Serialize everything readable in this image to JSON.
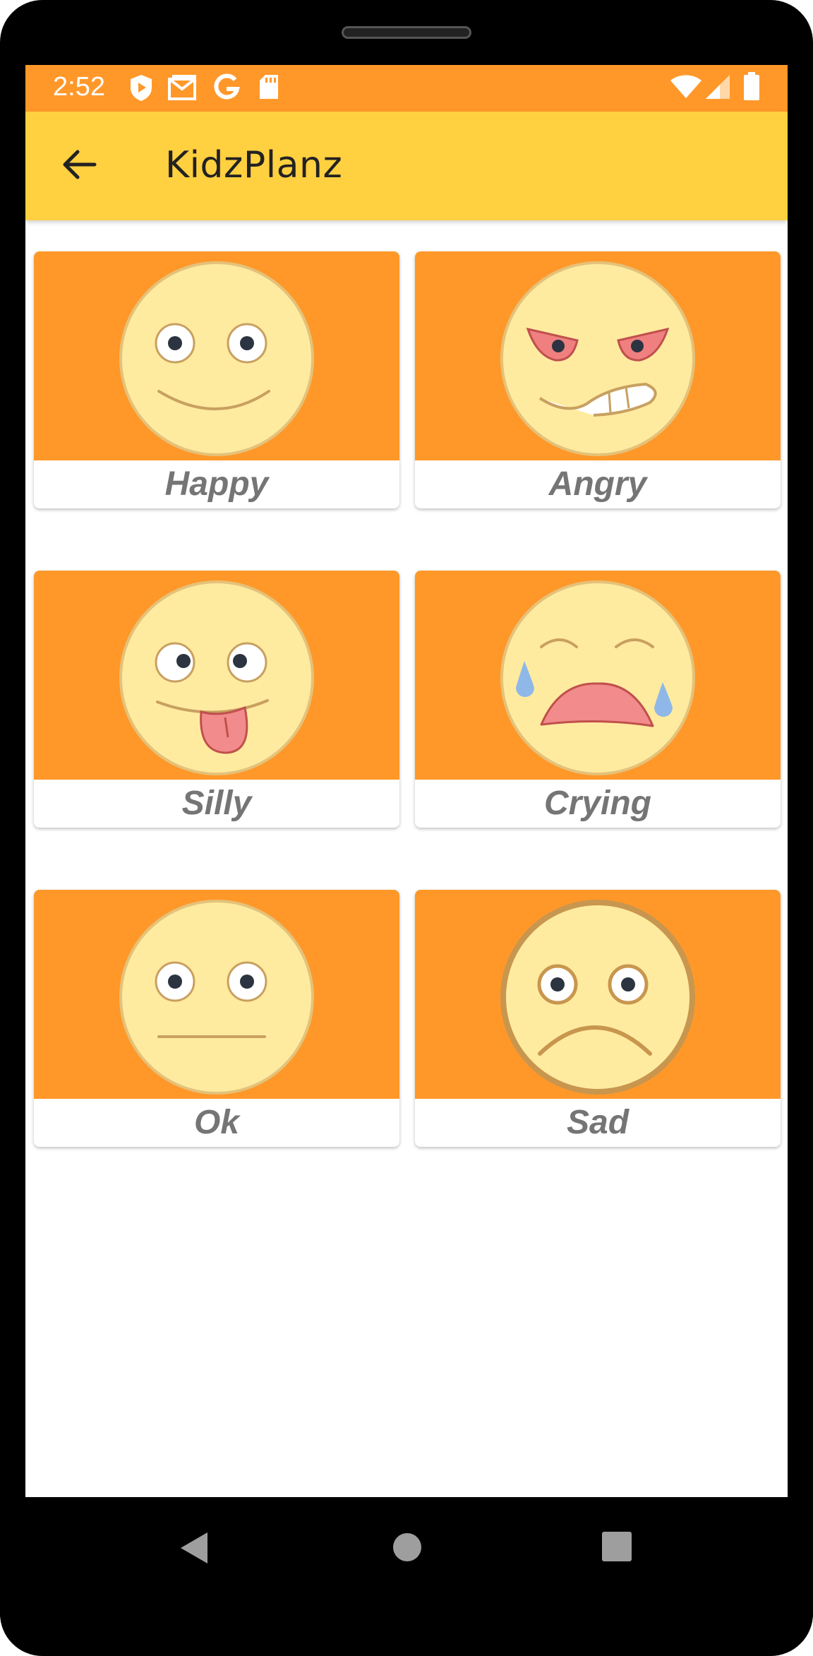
{
  "status_bar": {
    "time": "2:52",
    "icons_left": [
      "play-protect-icon",
      "gmail-icon",
      "google-icon",
      "sd-card-icon"
    ],
    "icons_right": [
      "wifi-icon",
      "signal-icon",
      "battery-icon"
    ]
  },
  "app_bar": {
    "title": "KidzPlanz",
    "back_icon": "arrow-back-icon"
  },
  "moods": [
    {
      "label": "Happy",
      "icon": "happy-face-icon"
    },
    {
      "label": "Angry",
      "icon": "angry-face-icon"
    },
    {
      "label": "Silly",
      "icon": "silly-face-icon"
    },
    {
      "label": "Crying",
      "icon": "crying-face-icon"
    },
    {
      "label": "Ok",
      "icon": "neutral-face-icon"
    },
    {
      "label": "Sad",
      "icon": "sad-face-icon"
    }
  ],
  "colors": {
    "status_bar": "#FF9829",
    "app_bar": "#FFD040",
    "card_image_bg": "#FF9829",
    "face": "#FFEBA0",
    "label_text": "#757575"
  },
  "nav_bar": {
    "buttons": [
      "back-nav-icon",
      "home-nav-icon",
      "recents-nav-icon"
    ]
  }
}
